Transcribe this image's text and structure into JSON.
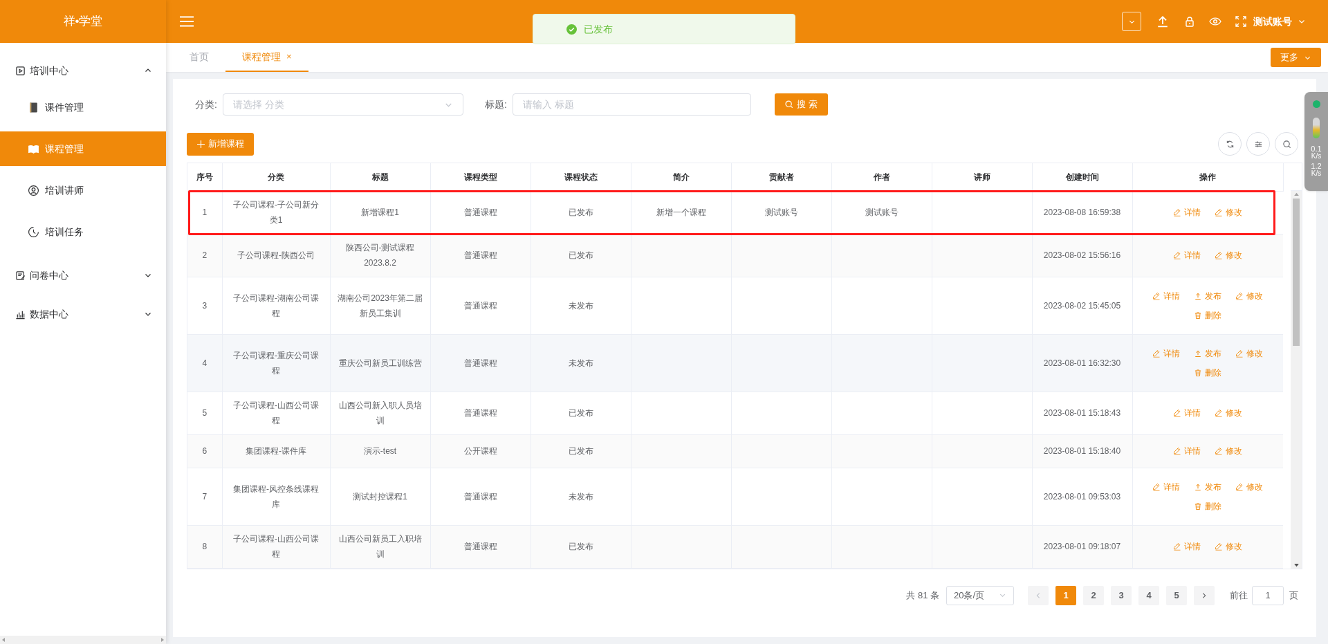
{
  "app": {
    "logo": "祥•学堂",
    "user": "测试账号"
  },
  "toast": {
    "message": "已发布",
    "kind": "success"
  },
  "sidebar": {
    "items": [
      {
        "label": "培训中心",
        "kind": "play",
        "expanded": true,
        "selected": false,
        "children": [
          {
            "label": "课件管理",
            "kind": "book",
            "selected": false
          },
          {
            "label": "课程管理",
            "kind": "openbook",
            "selected": true
          },
          {
            "label": "培训讲师",
            "kind": "person",
            "selected": false
          },
          {
            "label": "培训任务",
            "kind": "clock",
            "selected": false
          }
        ]
      },
      {
        "label": "问卷中心",
        "kind": "form",
        "expanded": false,
        "selected": false
      },
      {
        "label": "数据中心",
        "kind": "chart",
        "expanded": false,
        "selected": false
      }
    ]
  },
  "tabs": [
    {
      "label": "首页",
      "selected": false,
      "closable": false
    },
    {
      "label": "课程管理",
      "selected": true,
      "closable": true,
      "close": "×"
    }
  ],
  "more_button": "更多",
  "filters": {
    "category_label": "分类:",
    "category_placeholder": "请选择 分类",
    "title_label": "标题:",
    "title_placeholder": "请输入 标题",
    "search_button": "搜 索"
  },
  "add_button": "新增课程",
  "table": {
    "columns": [
      "序号",
      "分类",
      "标题",
      "课程类型",
      "课程状态",
      "简介",
      "贡献者",
      "作者",
      "讲师",
      "创建时间",
      "操作"
    ],
    "rows": [
      {
        "index": "1",
        "category": "子公司课程-子公司新分类1",
        "title": "新增课程1",
        "type": "普通课程",
        "status": "已发布",
        "intro": "新增一个课程",
        "contributor": "测试账号",
        "author": "测试账号",
        "created": "2023-08-08 16:59:38",
        "highlighted": true,
        "actions": [
          {
            "kind": "edit",
            "label": "详情"
          },
          {
            "kind": "edit",
            "label": "修改"
          }
        ]
      },
      {
        "index": "2",
        "category": "子公司课程-陕西公司",
        "title": "陕西公司-测试课程2023.8.2",
        "type": "普通课程",
        "status": "已发布",
        "created": "2023-08-02 15:56:16",
        "highlighted": false,
        "actions": [
          {
            "kind": "edit",
            "label": "详情"
          },
          {
            "kind": "edit",
            "label": "修改"
          }
        ]
      },
      {
        "index": "3",
        "category": "子公司课程-湖南公司课程",
        "title": "湖南公司2023年第二届新员工集训",
        "type": "普通课程",
        "status": "未发布",
        "created": "2023-08-02 15:45:05",
        "highlighted": false,
        "actions": [
          {
            "kind": "edit",
            "label": "详情"
          },
          {
            "kind": "upload",
            "label": "发布"
          },
          {
            "kind": "edit",
            "label": "修改"
          },
          {
            "kind": "delete",
            "label": "删除"
          }
        ]
      },
      {
        "index": "4",
        "category": "子公司课程-重庆公司课程",
        "title": "重庆公司新员工训练营",
        "type": "普通课程",
        "status": "未发布",
        "created": "2023-08-01 16:32:30",
        "highlighted": false,
        "actions": [
          {
            "kind": "edit",
            "label": "详情"
          },
          {
            "kind": "upload",
            "label": "发布"
          },
          {
            "kind": "edit",
            "label": "修改"
          },
          {
            "kind": "delete",
            "label": "删除"
          }
        ]
      },
      {
        "index": "5",
        "category": "子公司课程-山西公司课程",
        "title": "山西公司新入职人员培训",
        "type": "普通课程",
        "status": "已发布",
        "created": "2023-08-01 15:18:43",
        "highlighted": false,
        "actions": [
          {
            "kind": "edit",
            "label": "详情"
          },
          {
            "kind": "edit",
            "label": "修改"
          }
        ]
      },
      {
        "index": "6",
        "category": "集团课程-课件库",
        "title": "演示-test",
        "type": "公开课程",
        "status": "已发布",
        "created": "2023-08-01 15:18:40",
        "highlighted": false,
        "actions": [
          {
            "kind": "edit",
            "label": "详情"
          },
          {
            "kind": "edit",
            "label": "修改"
          }
        ]
      },
      {
        "index": "7",
        "category": "集团课程-风控条线课程库",
        "title": "测试封控课程1",
        "type": "普通课程",
        "status": "未发布",
        "created": "2023-08-01 09:53:03",
        "highlighted": false,
        "actions": [
          {
            "kind": "edit",
            "label": "详情"
          },
          {
            "kind": "upload",
            "label": "发布"
          },
          {
            "kind": "edit",
            "label": "修改"
          },
          {
            "kind": "delete",
            "label": "删除"
          }
        ]
      },
      {
        "index": "8",
        "category": "子公司课程-山西公司课程",
        "title": "山西公司新员工入职培训",
        "type": "普通课程",
        "status": "已发布",
        "created": "2023-08-01 09:18:07",
        "highlighted": false,
        "actions": [
          {
            "kind": "edit",
            "label": "详情"
          },
          {
            "kind": "edit",
            "label": "修改"
          }
        ]
      }
    ]
  },
  "pagination": {
    "total": "共 81 条",
    "page_size": "20条/页",
    "pages": [
      {
        "label": "1",
        "selected": true
      },
      {
        "label": "2",
        "selected": false
      },
      {
        "label": "3",
        "selected": false
      },
      {
        "label": "4",
        "selected": false
      },
      {
        "label": "5",
        "selected": false
      }
    ],
    "goto_label": "前往",
    "goto_value": "1",
    "goto_suffix": "页"
  },
  "net_widget": {
    "up": "0.1",
    "up_unit": "K/s",
    "down": "1.2",
    "down_unit": "K/s"
  }
}
